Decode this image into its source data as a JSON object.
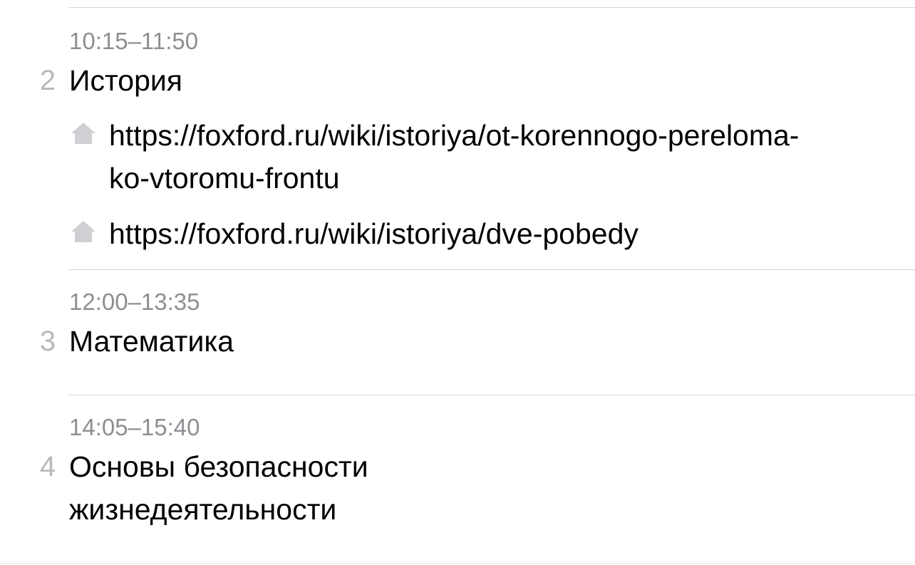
{
  "lessons": [
    {
      "number": "2",
      "time": "10:15–11:50",
      "subject": "История",
      "homework": [
        {
          "icon": "home-icon",
          "text": "https://foxford.ru/wiki/istoriya/ot-korennogo-pereloma-ko-vtoromu-frontu"
        },
        {
          "icon": "home-icon",
          "text": "https://foxford.ru/wiki/istoriya/dve-pobedy"
        }
      ]
    },
    {
      "number": "3",
      "time": "12:00–13:35",
      "subject": "Математика",
      "homework": []
    },
    {
      "number": "4",
      "time": "14:05–15:40",
      "subject_line1": "Основы безопасности",
      "subject_line2": "жизнедеятельности",
      "homework": []
    }
  ],
  "colors": {
    "time": "#8e8e93",
    "number": "#b8b8bd",
    "icon": "#d0d0d4",
    "divider": "#d6d6d6"
  }
}
